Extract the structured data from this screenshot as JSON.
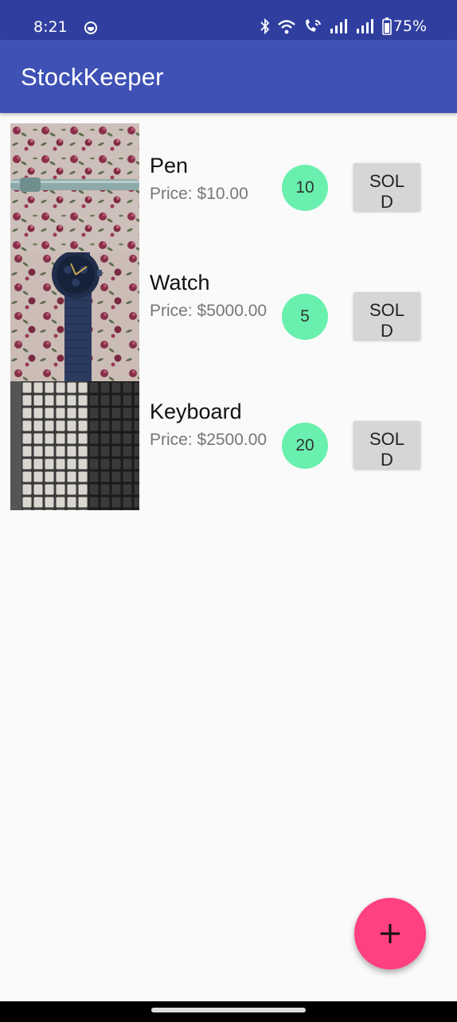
{
  "status_bar": {
    "time": "8:21",
    "battery": "75%",
    "icons": [
      "notification-app-icon",
      "bluetooth-icon",
      "wifi-icon",
      "wifi-calling-icon",
      "signal-icon",
      "signal-icon",
      "battery-icon"
    ]
  },
  "app_bar": {
    "title": "StockKeeper"
  },
  "items": [
    {
      "name": "Pen",
      "price": "Price: $10.00",
      "quantity": "10",
      "sold_label": "SOLD",
      "image": "pen-photo"
    },
    {
      "name": "Watch",
      "price": "Price: $5000.00",
      "quantity": "5",
      "sold_label": "SOLD",
      "image": "watch-photo"
    },
    {
      "name": "Keyboard",
      "price": "Price: $2500.00",
      "quantity": "20",
      "sold_label": "SOLD",
      "image": "keyboard-photo"
    }
  ],
  "fab": {
    "icon": "plus-icon"
  },
  "colors": {
    "status_bar": "#303f9f",
    "app_bar": "#3f51b5",
    "quantity_badge": "#69f0ae",
    "fab": "#ff4081",
    "sold_button": "#d6d6d6"
  }
}
